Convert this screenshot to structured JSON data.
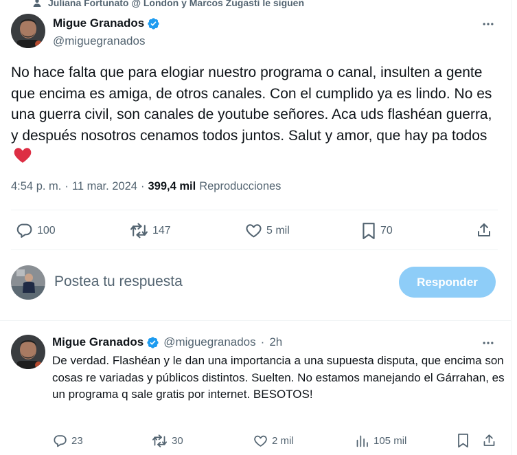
{
  "social_context": "Juliana Fortunato @ London y Marcos Zugasti le siguen",
  "main_tweet": {
    "author_name": "Migue Granados",
    "author_handle": "@miguegranados",
    "text": "No hace falta que para elogiar nuestro programa o canal, insulten a gente que encima es amiga, de otros canales. Con el cumplido ya es lindo. No es una guerra civil, son canales de youtube señores. Aca uds flashéan guerra, y después nosotros cenamos todos juntos. Salut y amor, que hay pa todos",
    "time": "4:54 p. m.",
    "sep1": "·",
    "date": "11 mar. 2024",
    "sep2": "·",
    "views": "399,4 mil",
    "views_label": "Reproducciones",
    "stats": {
      "replies": "100",
      "reposts": "147",
      "likes": "5 mil",
      "bookmarks": "70"
    }
  },
  "composer": {
    "placeholder": "Postea tu respuesta",
    "button_label": "Responder"
  },
  "reply_tweet": {
    "author_name": "Migue Granados",
    "author_handle": "@miguegranados",
    "sep": "·",
    "time_ago": "2h",
    "text": "De verdad. Flashéan y le dan una importancia a una supuesta disputa, que encima son cosas re variadas y públicos distintos. Suelten. No estamos manejando el Gárrahan, es un programa q sale gratis por internet. BESOTOS!",
    "stats": {
      "replies": "23",
      "reposts": "30",
      "likes": "2 mil",
      "views": "105 mil"
    }
  },
  "colors": {
    "accent": "#1d9bf0",
    "button_disabled": "#8ecdf8",
    "secondary_text": "#536471",
    "heart": "#f91880"
  }
}
